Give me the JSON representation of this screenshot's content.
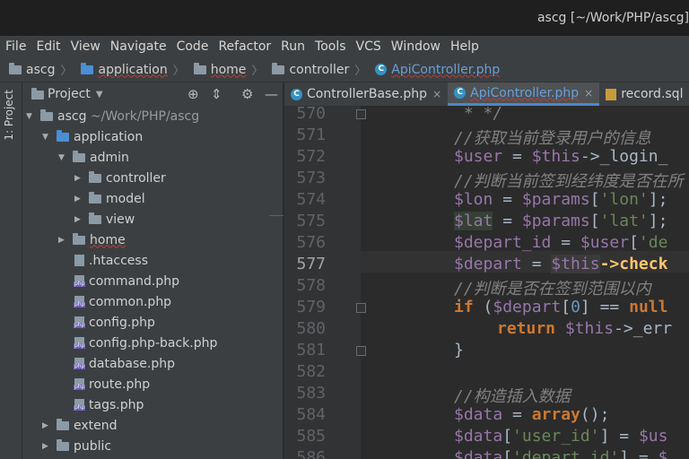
{
  "window": {
    "title": "ascg [~/Work/PHP/ascg]"
  },
  "menu": [
    "File",
    "Edit",
    "View",
    "Navigate",
    "Code",
    "Refactor",
    "Run",
    "Tools",
    "VCS",
    "Window",
    "Help"
  ],
  "breadcrumb": [
    "ascg",
    "application",
    "home",
    "controller",
    "ApiController.php"
  ],
  "side_tab": "1: Project",
  "project_panel": {
    "title": "Project"
  },
  "tree": [
    {
      "label": "ascg",
      "hint": "~/Work/PHP/ascg"
    },
    {
      "label": "application"
    },
    {
      "label": "admin"
    },
    {
      "label": "controller"
    },
    {
      "label": "model"
    },
    {
      "label": "view"
    },
    {
      "label": "home"
    },
    {
      "label": ".htaccess"
    },
    {
      "label": "command.php"
    },
    {
      "label": "common.php"
    },
    {
      "label": "config.php"
    },
    {
      "label": "config.php-back.php"
    },
    {
      "label": "database.php"
    },
    {
      "label": "route.php"
    },
    {
      "label": "tags.php"
    },
    {
      "label": "extend"
    },
    {
      "label": "public"
    }
  ],
  "tabs": [
    {
      "label": "ControllerBase.php"
    },
    {
      "label": "ApiController.php"
    },
    {
      "label": "record.sql"
    }
  ],
  "line_numbers": [
    "570",
    "571",
    "572",
    "573",
    "574",
    "575",
    "576",
    "577",
    "578",
    "579",
    "580",
    "581",
    "582",
    "583",
    "584",
    "585",
    "586"
  ],
  "code": {
    "l570": " * */",
    "l571": "//获取当前登录用户的信息",
    "l572_var": "$user",
    "l572_eq": " = ",
    "l572_this": "$this",
    "l572_rest": "->_login_",
    "l573": "//判断当前签到经纬度是否在所",
    "l574_var": "$lon",
    "l574_mid": " = ",
    "l574_params": "$params",
    "l574_b1": "[",
    "l574_key": "'lon'",
    "l574_b2": "];",
    "l575_var": "$lat",
    "l575_mid": " = ",
    "l575_params": "$params",
    "l575_b1": "[",
    "l575_key": "'lat'",
    "l575_b2": "];",
    "l576_var": "$depart_id",
    "l576_mid": " = ",
    "l576_user": "$user",
    "l576_b1": "[",
    "l576_key": "'de",
    "l577_var": "$depart",
    "l577_mid": " = ",
    "l577_this": "$this",
    "l577_rest": "->check",
    "l578": "//判断是否在签到范围以内",
    "l579_kw": "if",
    "l579_a": " (",
    "l579_var": "$depart",
    "l579_b": "[",
    "l579_num": "0",
    "l579_c": "] == ",
    "l579_null": "null",
    "l580_kw": "return",
    "l580_sp": " ",
    "l580_this": "$this",
    "l580_rest": "->_err",
    "l581": "}",
    "l583": "//构造插入数据",
    "l584_var": "$data",
    "l584_mid": " = ",
    "l584_kw": "array",
    "l584_end": "();",
    "l585_var": "$data",
    "l585_b1": "[",
    "l585_key": "'user_id'",
    "l585_mid": "] = ",
    "l585_var2": "$us",
    "l586_var": "$data",
    "l586_b1": "[",
    "l586_key": "'depart_id'",
    "l586_mid": "] = ",
    "l586_var2": "$"
  },
  "colors": {
    "accent": "#4a88c7",
    "background": "#2b2b2b",
    "panel": "#3c3f41"
  }
}
